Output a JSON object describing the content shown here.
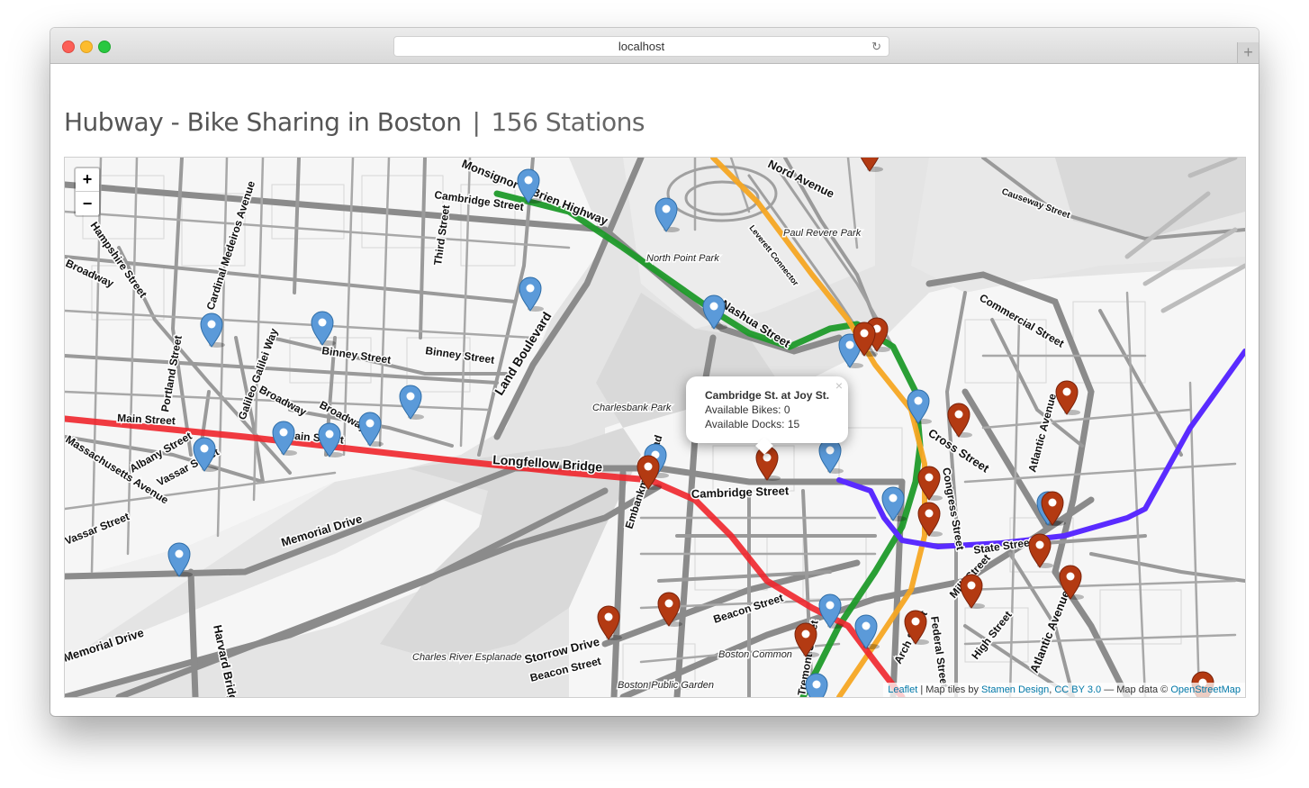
{
  "browser": {
    "url": "localhost"
  },
  "page": {
    "title": "Hubway - Bike Sharing in Boston",
    "separator": "|",
    "station_count": "156 Stations"
  },
  "map": {
    "zoom_in_label": "+",
    "zoom_out_label": "−",
    "popup": {
      "station": "Cambridge St. at Joy St.",
      "bikes_line": "Available Bikes: 0",
      "docks_line": "Available Docks: 15",
      "close_label": "×"
    },
    "attribution": {
      "leaflet": "Leaflet",
      "tiles_text": " | Map tiles by ",
      "stamen": "Stamen Design",
      "sep": ", ",
      "license": "CC BY 3.0",
      "data_text": " — Map data © ",
      "osm": "OpenStreetMap"
    },
    "street_labels": [
      "Cambridge Street",
      "Land Boulevard",
      "Binney Street",
      "Binney Street",
      "Main Street",
      "Main Street",
      "Longfellow Bridge",
      "Cambridge Street",
      "Memorial Drive",
      "Vassar Street",
      "Vassar Street",
      "Massachusetts Avenue",
      "Albany Street",
      "Broadway",
      "Broadway",
      "Broadway",
      "Galileo Galilei Way",
      "Portland Street",
      "Cardinal Medeiros Avenue",
      "Hampshire Street",
      "Third Street",
      "Nashua Street",
      "Leverett Connector",
      "Commercial Street",
      "Cross Street",
      "Atlantic Avenue",
      "Atlantic Avenue",
      "State Street",
      "Beacon Street",
      "Beacon Street",
      "Storrow Drive",
      "Harvard Bridge",
      "Memorial Drive",
      "Embankment Road",
      "Federal Street",
      "High Street",
      "Arch Street",
      "Milk Street",
      "Tremont Street",
      "Congress Street",
      "Causeway Street",
      "Nord Avenue",
      "Monsignor O'Brien Highway"
    ],
    "place_labels": [
      "North Point Park",
      "Paul Revere Park",
      "Charlesbank Park",
      "Charles River Esplanade",
      "Boston Common",
      "Boston Public Garden"
    ],
    "colors": {
      "marker_blue": "#5b9ad9",
      "marker_red": "#b33a12",
      "line_green": "#1f9a2a",
      "line_orange": "#f5a623",
      "line_red": "#f0262c",
      "line_blue": "#5a2bff"
    }
  }
}
